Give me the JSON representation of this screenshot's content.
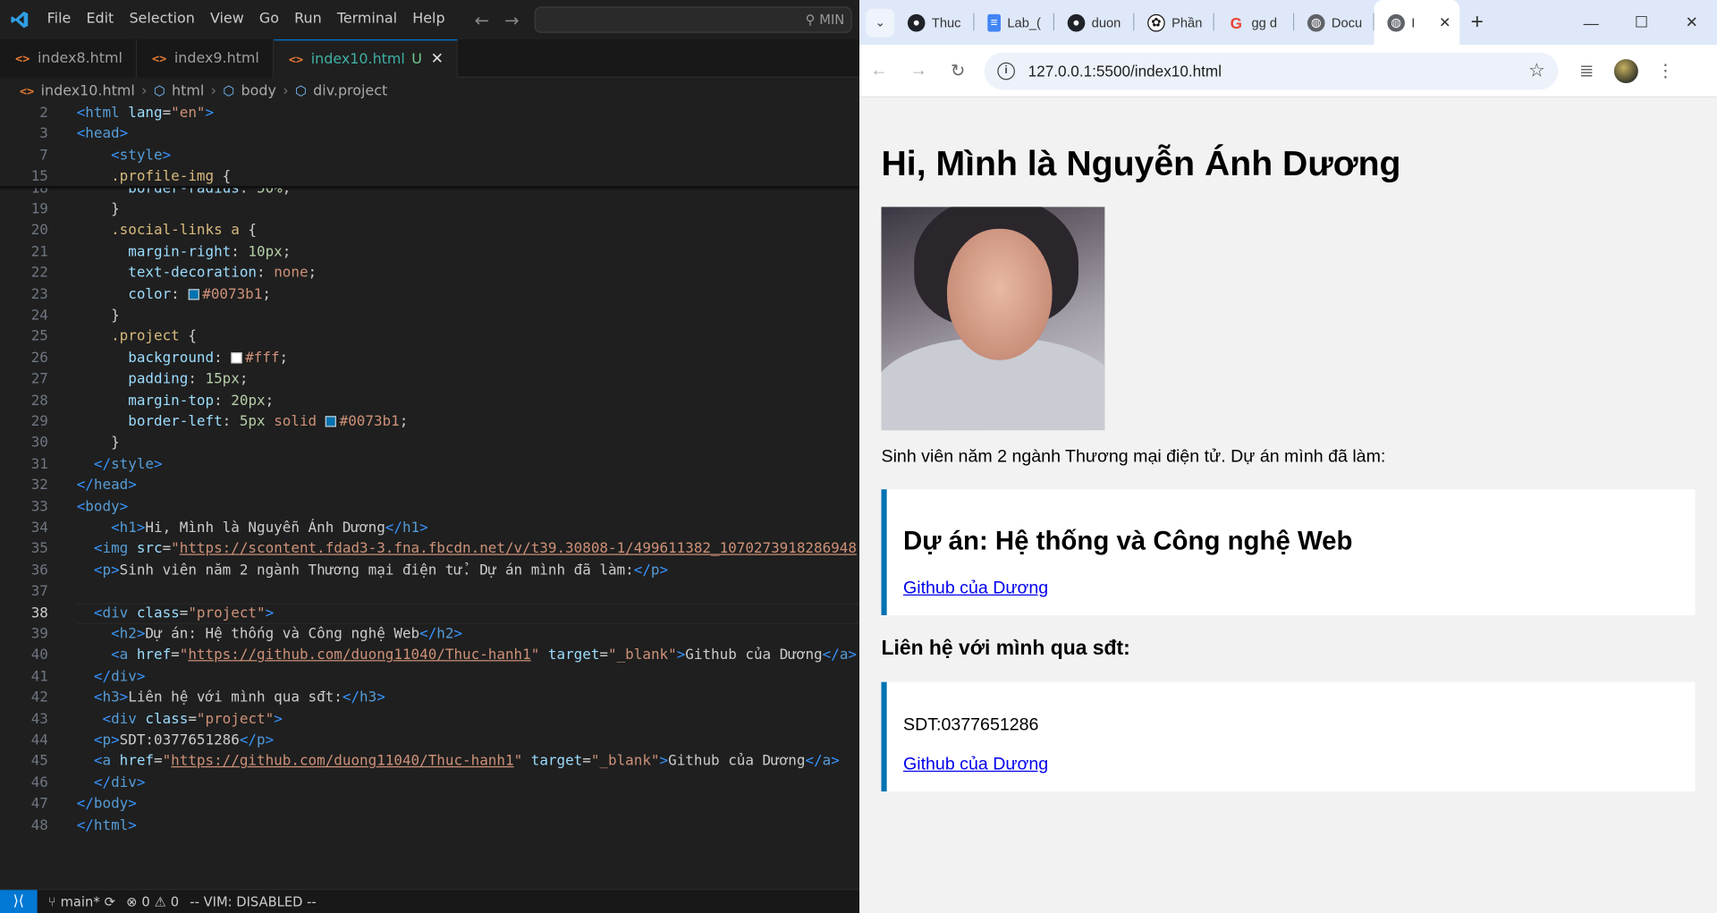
{
  "vscode": {
    "menu": [
      "File",
      "Edit",
      "Selection",
      "View",
      "Go",
      "Run",
      "Terminal",
      "Help"
    ],
    "command_center": "MIN",
    "tabs": [
      {
        "label": "index8.html"
      },
      {
        "label": "index9.html"
      },
      {
        "label": "index10.html",
        "modified": "U"
      }
    ],
    "breadcrumb": [
      "index10.html",
      "html",
      "body",
      "div.project"
    ],
    "status": {
      "branch": "main*",
      "errors": "0",
      "warnings": "0",
      "vim": "-- VIM: DISABLED --"
    }
  },
  "chrome": {
    "tabs": [
      {
        "label": "Thuc",
        "icon": "github-icon"
      },
      {
        "label": "Lab_(",
        "icon": "google-docs-icon"
      },
      {
        "label": "duon",
        "icon": "github-icon"
      },
      {
        "label": "Phần",
        "icon": "chatgpt-icon"
      },
      {
        "label": "gg d",
        "icon": "google-icon"
      },
      {
        "label": "Docu",
        "icon": "globe-icon"
      },
      {
        "label": "I",
        "icon": "globe-icon"
      }
    ],
    "url": "127.0.0.1:5500/index10.html",
    "page": {
      "h1": "Hi, Mình là Nguyễn Ánh Dương",
      "intro": "Sinh viên năm 2 ngành Thương mại điện tử. Dự án mình đã làm:",
      "project_title": "Dự án: Hệ thống và Công nghệ Web",
      "github_link": "Github của Dương",
      "contact_heading": "Liên hệ với mình qua sđt:",
      "phone": "SDT:0377651286",
      "github_link2": "Github của Dương"
    }
  },
  "colors": {
    "accent": "#0073b1",
    "vscode_blue": "#0078d4"
  }
}
